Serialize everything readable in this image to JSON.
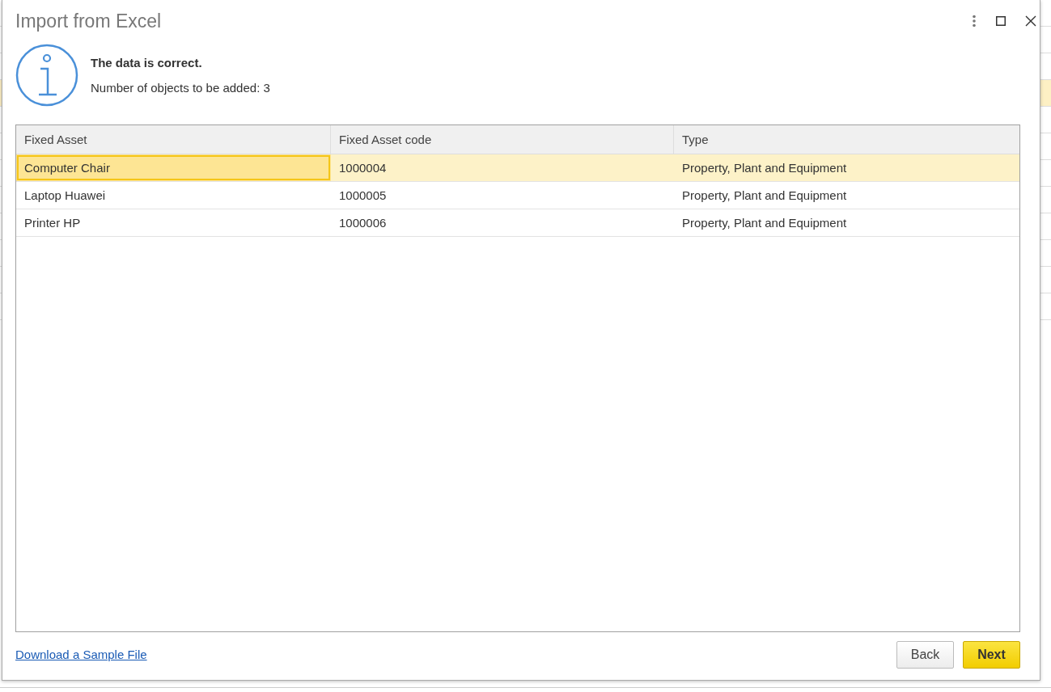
{
  "window": {
    "title": "Import from Excel"
  },
  "message": {
    "heading": "The data is correct.",
    "detail": "Number of objects to be added: 3"
  },
  "table": {
    "columns": [
      "Fixed Asset",
      "Fixed Asset code",
      "Type"
    ],
    "rows": [
      {
        "selected": true,
        "cells": [
          {
            "text": "Computer Chair",
            "focused": true
          },
          {
            "text": "1000004",
            "focused": false
          },
          {
            "text": "Property, Plant and Equipment",
            "focused": false
          }
        ]
      },
      {
        "selected": false,
        "cells": [
          {
            "text": "Laptop Huawei",
            "focused": false
          },
          {
            "text": "1000005",
            "focused": false
          },
          {
            "text": "Property, Plant and Equipment",
            "focused": false
          }
        ]
      },
      {
        "selected": false,
        "cells": [
          {
            "text": "Printer HP",
            "focused": false
          },
          {
            "text": "1000006",
            "focused": false
          },
          {
            "text": "Property, Plant and Equipment",
            "focused": false
          }
        ]
      }
    ]
  },
  "footer": {
    "link": "Download a Sample File",
    "buttons": [
      {
        "label": "Back",
        "primary": false
      },
      {
        "label": "Next",
        "primary": true
      }
    ]
  }
}
